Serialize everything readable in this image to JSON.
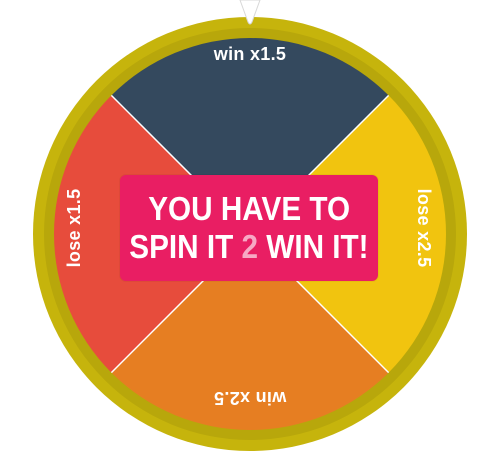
{
  "wheel": {
    "segments": [
      {
        "label": "win x1.5",
        "color": "#34495e",
        "position": "top"
      },
      {
        "label": "lose x2.5",
        "color": "#f1c40f",
        "position": "right"
      },
      {
        "label": "win x2.5",
        "color": "#e67e22",
        "position": "bottom"
      },
      {
        "label": "lose x1.5",
        "color": "#e74c3c",
        "position": "left"
      }
    ],
    "rim_color": "#c6b40c",
    "rim_inner_color": "#a89a0a",
    "divider_color": "#ffffff",
    "label_color": "#ffffff"
  },
  "center_button": {
    "line1": "YOU HAVE TO",
    "line2_start": "SPIN IT ",
    "line2_accent": "2",
    "line2_end": " WIN IT!",
    "background": "#e91e63",
    "accent_color": "#f7a8c4"
  },
  "pointer": {
    "icon": "pointer-triangle-icon",
    "color": "#ffffff"
  }
}
